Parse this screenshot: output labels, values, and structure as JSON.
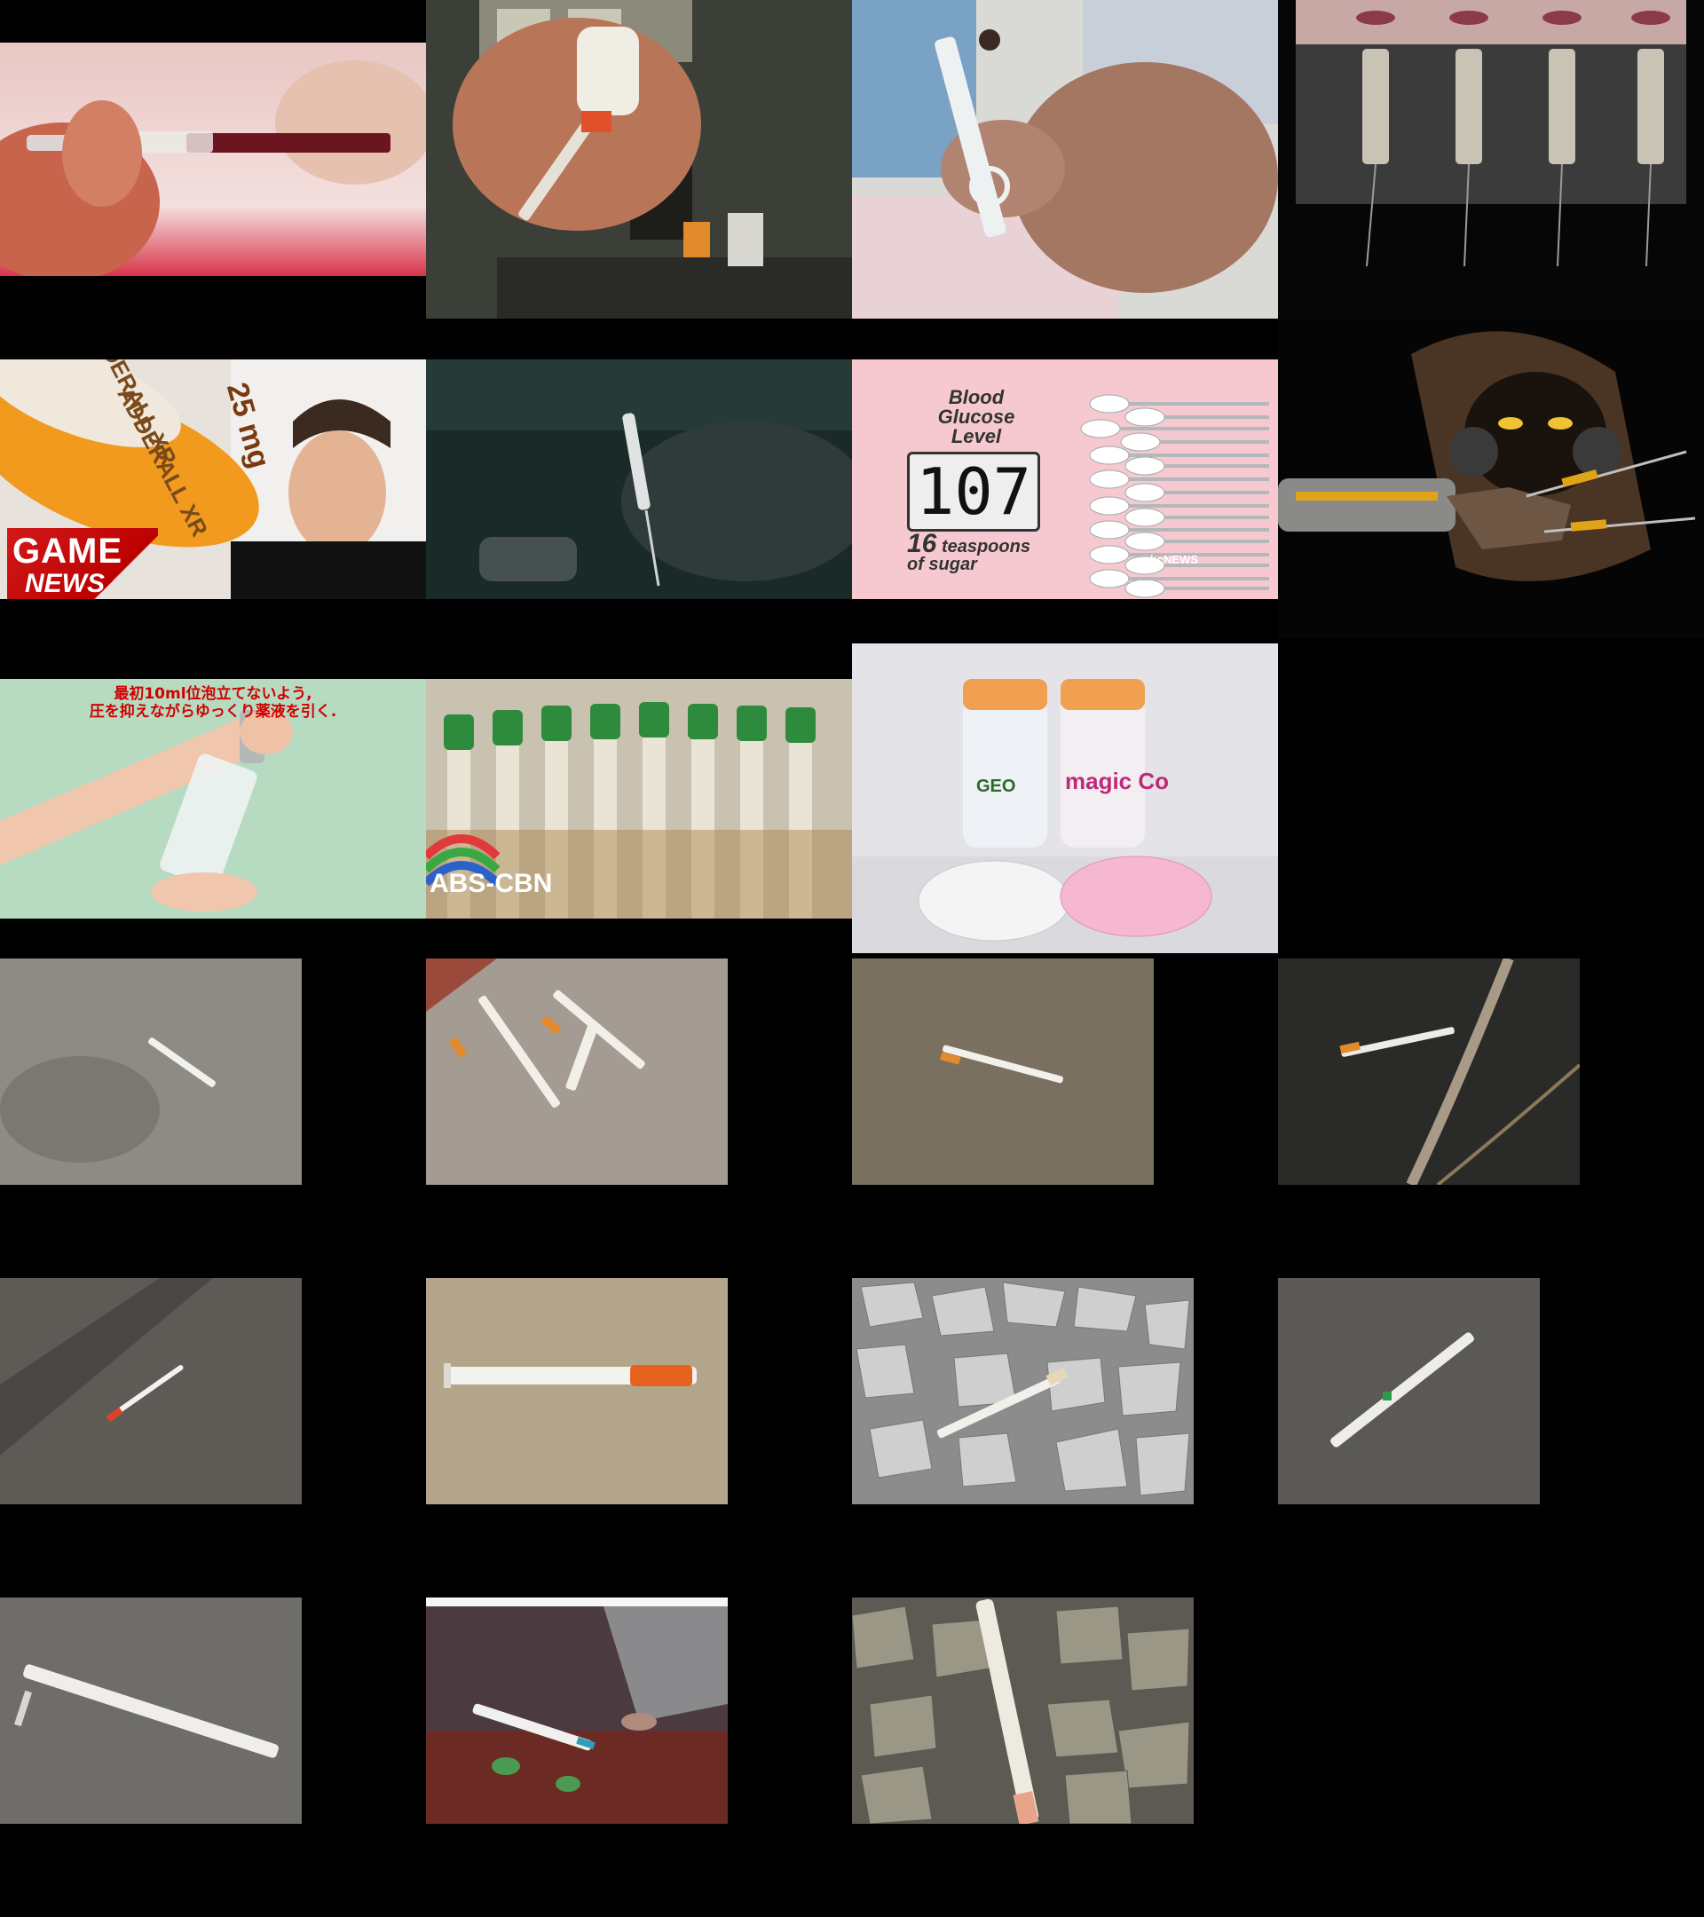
{
  "grid": {
    "background": "#000000"
  },
  "thumbs": {
    "t1": {
      "icon": "syringe-blood-draw"
    },
    "t2": {
      "icon": "syringe-kitchen"
    },
    "t3": {
      "icon": "syringe-hands-newspaper"
    },
    "t4": {
      "icon": "syringes-hanging-dark"
    },
    "t5": {
      "icon": "pills-presenter",
      "badge_line1": "GAME",
      "badge_line2": "NEWS",
      "pill_text1": "ADDERALL XR",
      "pill_text2": "25 mg",
      "pill_text3": "ADDERALL XR"
    },
    "t6": {
      "icon": "syringe-gloved-hand"
    },
    "t7": {
      "icon": "blood-glucose-infographic",
      "title_line1": "Blood",
      "title_line2": "Glucose",
      "title_line3": "Level",
      "reading": "107",
      "count": "16",
      "line_a": "teaspoons",
      "line_b": "of sugar",
      "network": "abcNEWS"
    },
    "t8": {
      "icon": "hooded-figure-syringe-claw"
    },
    "t9": {
      "icon": "syringe-arm-japanese",
      "caption_line1": "最初10ml位泡立てないよう,",
      "caption_line2": "圧を抑えながらゆっくり薬液を引く."
    },
    "t10": {
      "icon": "blood-vials",
      "logo": "ABS-CBN"
    },
    "t11": {
      "icon": "contact-lens-vials",
      "brand1": "GEO",
      "brand2": "magic Co"
    },
    "t12": {
      "icon": "syringe-concrete"
    },
    "t13": {
      "icon": "syringes-sidewalk"
    },
    "t14": {
      "icon": "syringe-dirt"
    },
    "t15": {
      "icon": "syringe-dark-ground"
    },
    "t16": {
      "icon": "syringe-asphalt"
    },
    "t17": {
      "icon": "syringe-pavement-orange"
    },
    "t18": {
      "icon": "syringe-gravel"
    },
    "t19": {
      "icon": "syringe-grey-ground"
    },
    "t20": {
      "icon": "syringe-asphalt-close"
    },
    "t21": {
      "icon": "syringe-soil-plants"
    },
    "t22": {
      "icon": "syringe-rocks"
    }
  }
}
